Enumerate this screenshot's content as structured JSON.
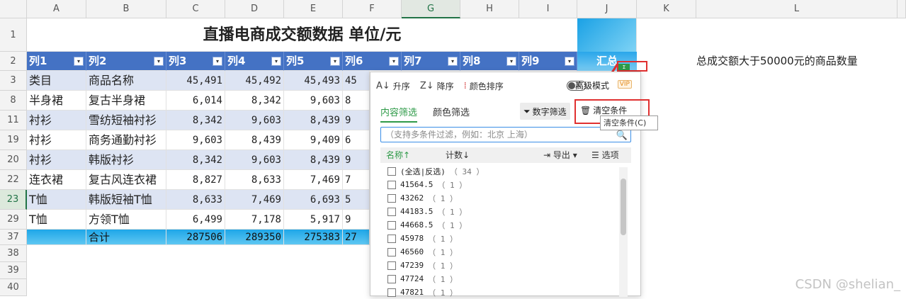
{
  "columns": [
    "A",
    "B",
    "C",
    "D",
    "E",
    "F",
    "G",
    "H",
    "I",
    "J",
    "K",
    "L"
  ],
  "rows": [
    "1",
    "2",
    "3",
    "8",
    "11",
    "19",
    "20",
    "22",
    "23",
    "29",
    "37",
    "38",
    "39",
    "40"
  ],
  "title": "直播电商成交额数据 单位/元",
  "header_row": [
    "列1",
    "列2",
    "列3",
    "列4",
    "列5",
    "列6",
    "列7",
    "列8",
    "列9",
    "汇总"
  ],
  "note": "总成交额大于50000元的商品数量",
  "data_rows": [
    [
      "类目",
      "商品名称",
      "45,491",
      "45,492",
      "45,493",
      "45"
    ],
    [
      "半身裙",
      "复古半身裙",
      "6,014",
      "8,342",
      "9,603",
      "8"
    ],
    [
      "衬衫",
      "雪纺短袖衬衫",
      "8,342",
      "9,603",
      "8,439",
      "9"
    ],
    [
      "衬衫",
      "商务通勤衬衫",
      "9,603",
      "8,439",
      "9,409",
      "6"
    ],
    [
      "衬衫",
      "韩版衬衫",
      "8,342",
      "9,603",
      "8,439",
      "9"
    ],
    [
      "连衣裙",
      "复古风连衣裙",
      "8,827",
      "8,633",
      "7,469",
      "7"
    ],
    [
      "T恤",
      "韩版短袖T恤",
      "8,633",
      "7,469",
      "6,693",
      "5"
    ],
    [
      "T恤",
      "方领T恤",
      "6,499",
      "7,178",
      "5,917",
      "9"
    ]
  ],
  "total_row": [
    "",
    "合计",
    "287506",
    "289350",
    "275383",
    "27"
  ],
  "filter_panel": {
    "sort_asc": "升序",
    "sort_desc": "降序",
    "sort_color": "颜色排序",
    "toggle_label": "关",
    "advanced_mode": "高级模式",
    "vip": "VIP",
    "tab_content": "内容筛选",
    "tab_color": "颜色筛选",
    "number_filter": "数字筛选",
    "clear_condition": "清空条件",
    "search_placeholder": "（支持多条件过滤，例如：北京  上海）",
    "list_name": "名称↑",
    "list_count": "计数↓",
    "export": "导出",
    "options": "选项",
    "select_all": "(全选|反选)",
    "select_all_count": "（ 34 ）",
    "items": [
      {
        "value": "41564.5",
        "count": "（ 1 ）"
      },
      {
        "value": "43262",
        "count": "（ 1 ）"
      },
      {
        "value": "44183.5",
        "count": "（ 1 ）"
      },
      {
        "value": "44668.5",
        "count": "（ 1 ）"
      },
      {
        "value": "45978",
        "count": "（ 1 ）"
      },
      {
        "value": "46560",
        "count": "（ 1 ）"
      },
      {
        "value": "47239",
        "count": "（ 1 ）"
      },
      {
        "value": "47724",
        "count": "（ 1 ）"
      },
      {
        "value": "47821",
        "count": "（ 1 ）"
      }
    ]
  },
  "tooltip": "清空条件(C)",
  "fill_handle": "Σ",
  "watermark": "CSDN @shelian_",
  "colors": {
    "header_blue": "#4472c4",
    "band": "#dde4f3",
    "accent_green": "#2e9a48",
    "highlight_red": "#e03030"
  }
}
